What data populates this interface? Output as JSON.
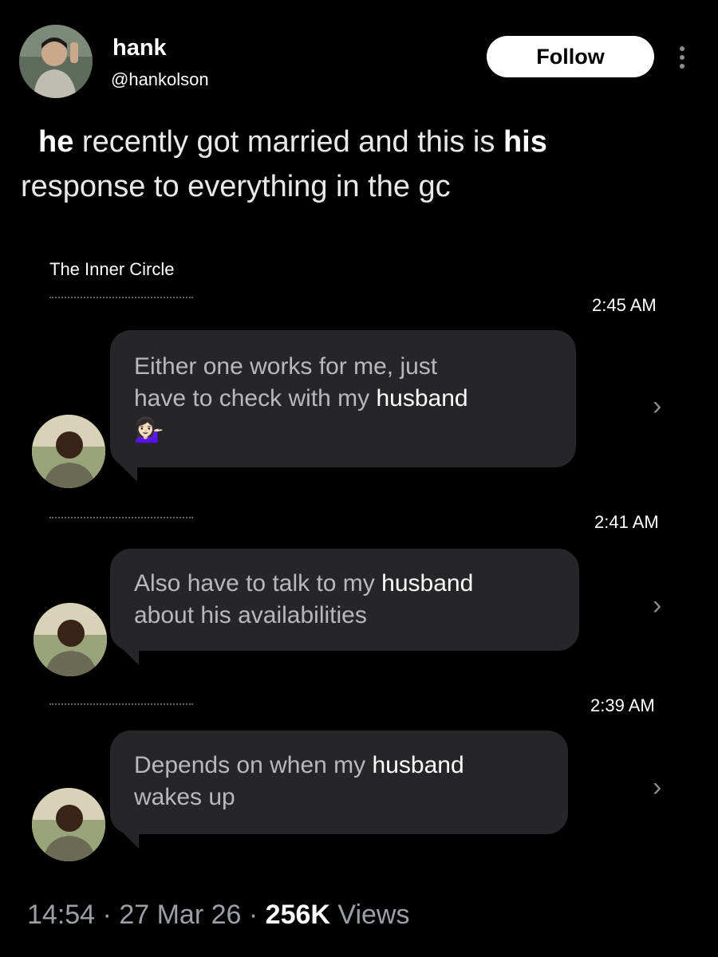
{
  "author": {
    "name": "hank",
    "handle": "@hankolson",
    "follow_label": "Follow"
  },
  "tweet": {
    "w1": "he",
    "w2": " recently got married and this is ",
    "w3": "his",
    "w4": "response to everything in the gc"
  },
  "chat": {
    "group_name": "The Inner Circle",
    "messages": [
      {
        "time": "2:45 AM",
        "pre": "Either one works for me, just\nhave to check with my ",
        "hl": "husband",
        "emoji": "💁🏻‍♀️"
      },
      {
        "time": "2:41 AM",
        "pre": "Also have to talk to my ",
        "hl": "husband",
        "post": "\nabout his availabilities"
      },
      {
        "time": "2:39 AM",
        "pre": "Depends on when my ",
        "hl": "husband",
        "post": "\nwakes up"
      }
    ]
  },
  "meta": {
    "time": "14:54",
    "date": "27 Mar 26",
    "views_count": "256K",
    "views_label": "Views",
    "sep": "·"
  }
}
